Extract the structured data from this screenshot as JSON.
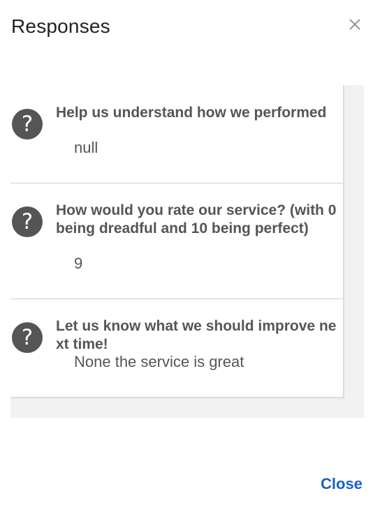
{
  "dialog": {
    "title": "Responses",
    "close_label": "Close"
  },
  "responses": [
    {
      "question": "Help us understand how we performed",
      "answer": "null",
      "icon": "question-icon"
    },
    {
      "question": "How would you rate our service? (with 0 being dreadful and 10 being perfect)",
      "answer": "9",
      "icon": "question-icon"
    },
    {
      "question": "Let us know what we should improve next time!",
      "answer": "None the service is great",
      "icon": "question-icon"
    }
  ],
  "colors": {
    "icon_bg": "#555555",
    "link": "#1a5fc9",
    "panel_bg": "#f2f2f2"
  }
}
